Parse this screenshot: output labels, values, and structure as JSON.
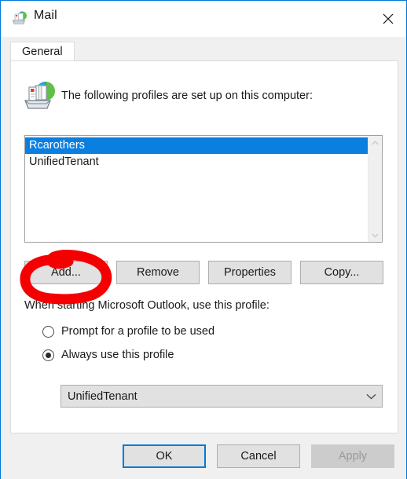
{
  "window": {
    "title": "Mail",
    "title_icon": "mail-profiles-icon",
    "close_icon": "close-icon",
    "border_color": "#0078d7"
  },
  "tabs": [
    {
      "label": "General",
      "active": true
    }
  ],
  "panel": {
    "icon": "mail-profiles-icon",
    "description": "The following profiles are set up on this computer:"
  },
  "profile_list": {
    "items": [
      {
        "label": "Rcarothers",
        "selected": true
      },
      {
        "label": "UnifiedTenant",
        "selected": false
      }
    ],
    "scrollbar": {
      "up_icon": "chevron-up-icon",
      "down_icon": "chevron-down-icon"
    }
  },
  "profile_buttons": [
    {
      "label": "Add...",
      "name": "add-button",
      "enabled": true
    },
    {
      "label": "Remove",
      "name": "remove-button",
      "enabled": true
    },
    {
      "label": "Properties",
      "name": "properties-button",
      "enabled": true
    },
    {
      "label": "Copy...",
      "name": "copy-button",
      "enabled": true
    }
  ],
  "startup": {
    "label": "When starting Microsoft Outlook, use this profile:",
    "options": [
      {
        "label": "Prompt for a profile to be used",
        "checked": false
      },
      {
        "label": "Always use this profile",
        "checked": true
      }
    ],
    "combo": {
      "value": "UnifiedTenant",
      "arrow_icon": "chevron-down-icon"
    }
  },
  "footer": {
    "ok_label": "OK",
    "cancel_label": "Cancel",
    "apply_label": "Apply"
  },
  "annotation": {
    "shape": "hand-drawn-ellipse",
    "color": "#f50000",
    "target": "add-button"
  }
}
